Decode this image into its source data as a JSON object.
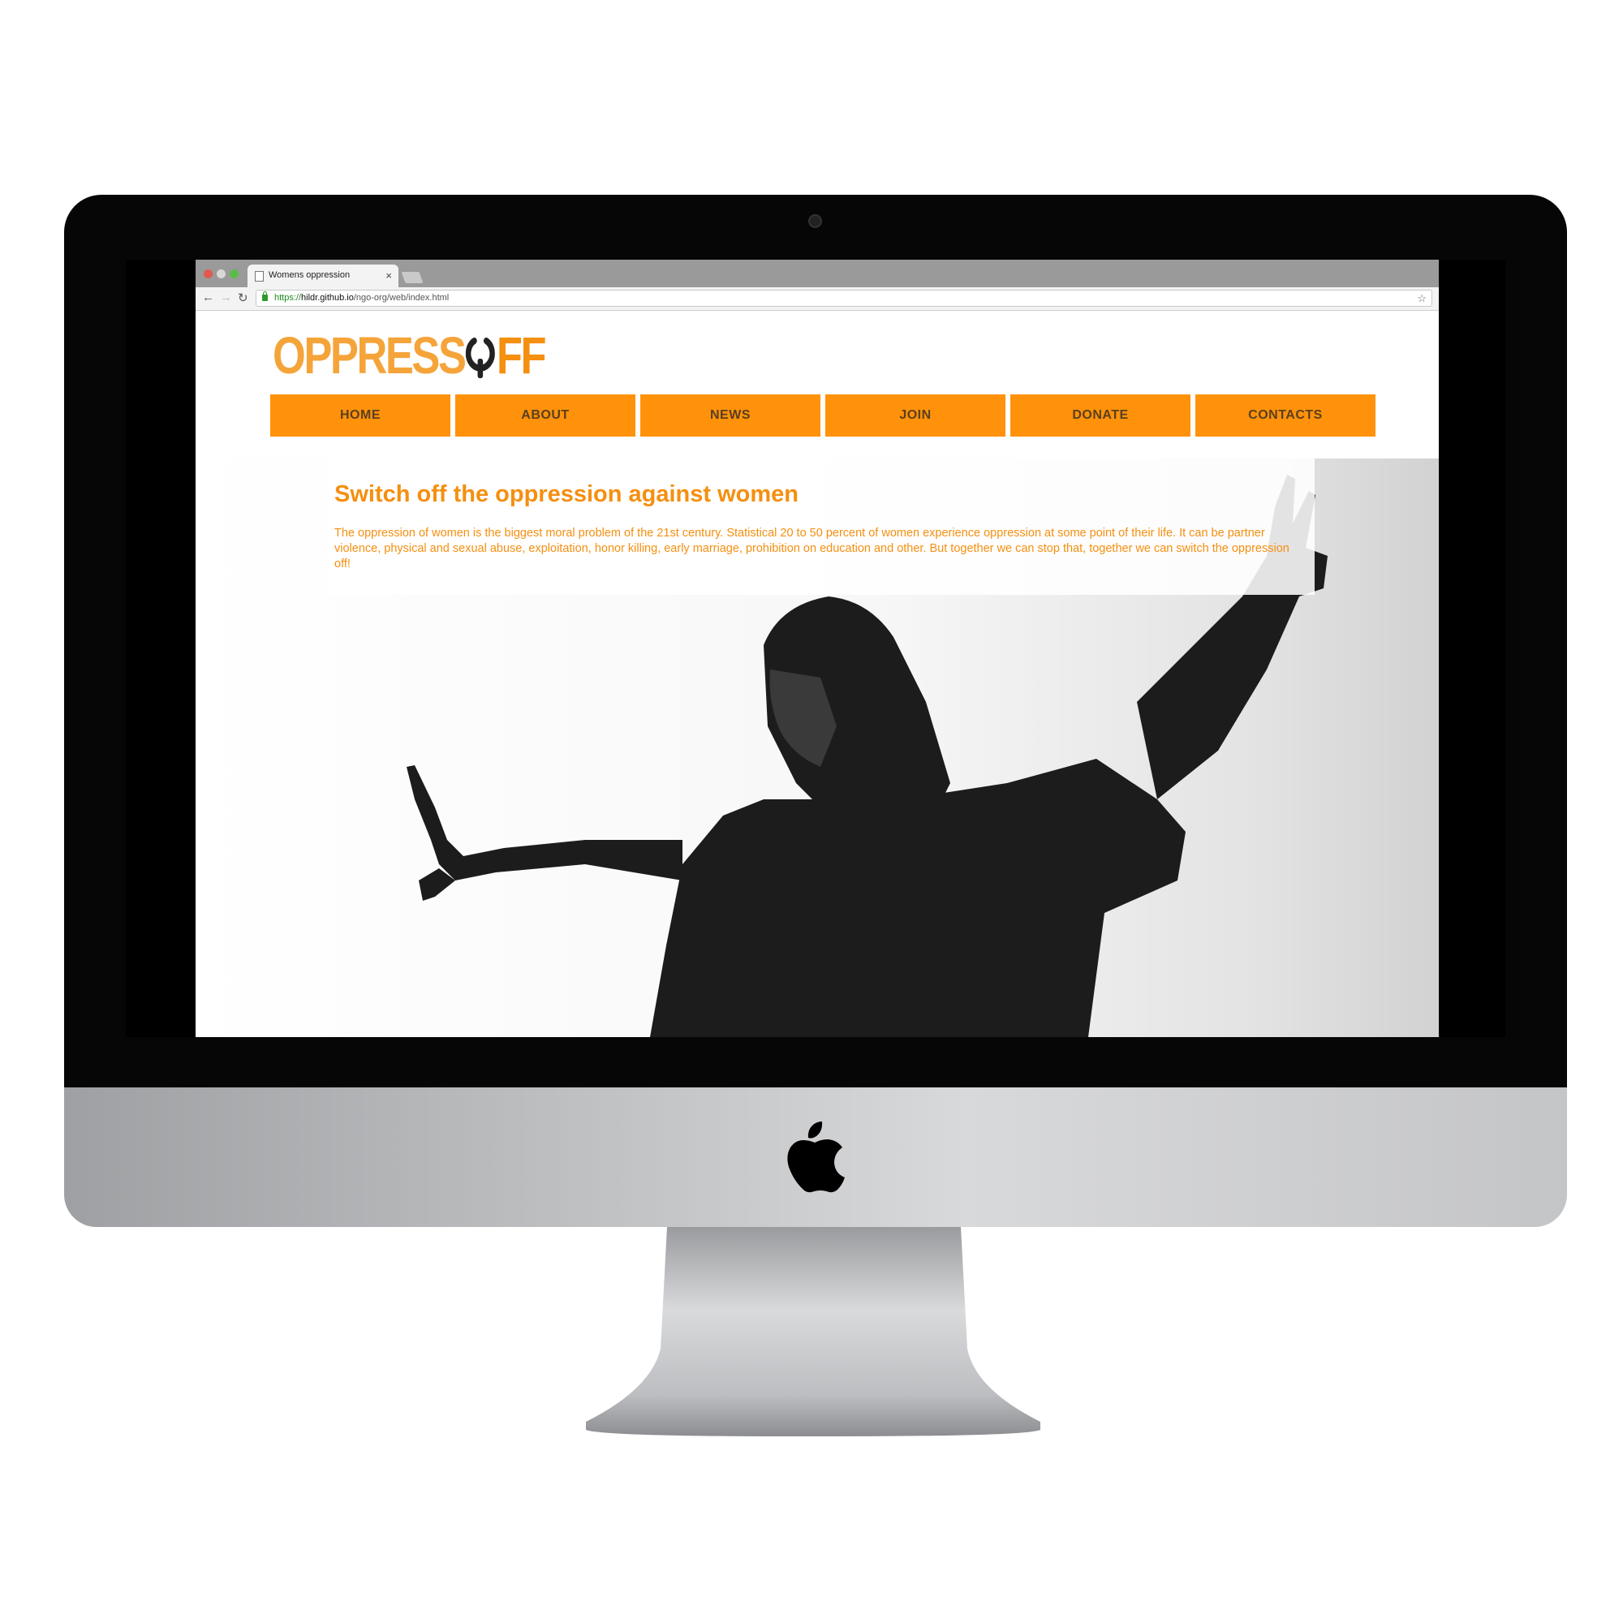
{
  "browser": {
    "tab_title": "Womens oppression",
    "tab_close": "×",
    "url_scheme": "https://",
    "url_host": "hildr.github.io",
    "url_path": "/ngo-org/web/index.html"
  },
  "site": {
    "logo_left": "OPPRESS",
    "logo_right": "FF",
    "menu": [
      {
        "label": "HOME"
      },
      {
        "label": "ABOUT"
      },
      {
        "label": "NEWS"
      },
      {
        "label": "JOIN"
      },
      {
        "label": "DONATE"
      },
      {
        "label": "CONTACTS"
      }
    ],
    "hero": {
      "title": "Switch off the oppression against women",
      "text": "The oppression of women is the biggest moral problem of the 21st century. Statistical 20 to 50 percent of women experience oppression at some point of their life. It can be partner violence, physical and sexual abuse, exploitation, honor killing, early marriage, prohibition on education and other. But together we can stop that, together we can switch the oppression off!"
    }
  },
  "colors": {
    "brand_orange": "#ff920a",
    "logo_orange": "#f5a43a",
    "menu_text": "#5a3f1e"
  }
}
